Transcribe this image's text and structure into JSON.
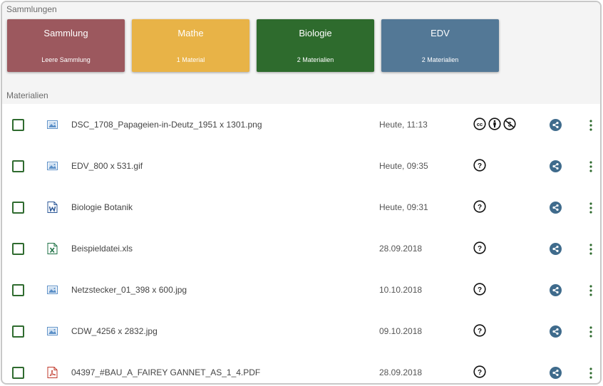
{
  "sections": {
    "collections_title": "Sammlungen",
    "materials_title": "Materialien"
  },
  "collections": [
    {
      "title": "Sammlung",
      "subtitle": "Leere Sammlung",
      "color": "#9c585e"
    },
    {
      "title": "Mathe",
      "subtitle": "1 Material",
      "color": "#e8b347"
    },
    {
      "title": "Biologie",
      "subtitle": "2 Materialien",
      "color": "#2e6b2d"
    },
    {
      "title": "EDV",
      "subtitle": "2 Materialien",
      "color": "#537896"
    }
  ],
  "materials": [
    {
      "name": "DSC_1708_Papageien-in-Deutz_1951 x 1301.png",
      "date": "Heute, 11:13",
      "type": "image-icon",
      "license": "cc-by-nc"
    },
    {
      "name": "EDV_800 x 531.gif",
      "date": "Heute, 09:35",
      "type": "image-icon",
      "license": "unknown"
    },
    {
      "name": "Biologie Botanik",
      "date": "Heute, 09:31",
      "type": "word-icon",
      "license": "unknown"
    },
    {
      "name": "Beispieldatei.xls",
      "date": "28.09.2018",
      "type": "excel-icon",
      "license": "unknown"
    },
    {
      "name": "Netzstecker_01_398 x 600.jpg",
      "date": "10.10.2018",
      "type": "image-icon",
      "license": "unknown"
    },
    {
      "name": "CDW_4256 x 2832.jpg",
      "date": "09.10.2018",
      "type": "image-icon",
      "license": "unknown"
    },
    {
      "name": "04397_#BAU_A_FAIREY GANNET_AS_1_4.PDF",
      "date": "28.09.2018",
      "type": "pdf-icon",
      "license": "unknown"
    }
  ],
  "colors": {
    "accent_green": "#2f6b2f",
    "share_blue": "#3f6b8c",
    "image_icon_blue": "#5b8fc7",
    "word_icon_blue": "#2b5797",
    "excel_icon_green": "#1e7145",
    "pdf_icon_red": "#c0392b"
  }
}
